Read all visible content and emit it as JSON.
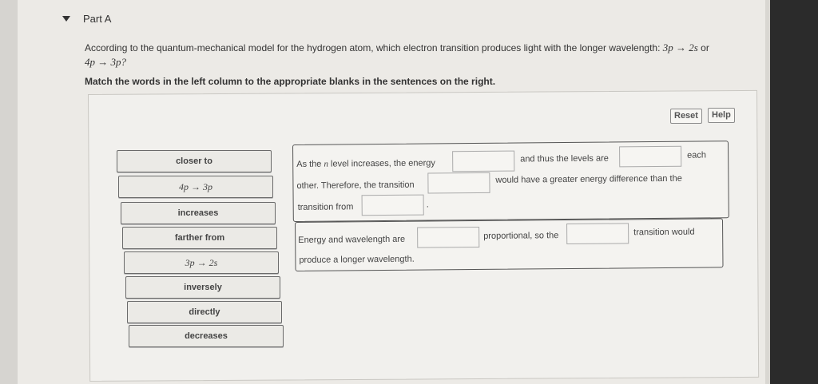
{
  "part": {
    "title": "Part A"
  },
  "question": {
    "text_before": "According to the quantum-mechanical model for the hydrogen atom, which electron transition produces light with the longer wavelength:",
    "transition_1": "3p → 2s",
    "joiner": "or",
    "transition_2": "4p → 3p?"
  },
  "instruction": "Match the words in the left column to the appropriate blanks in the sentences on the right.",
  "buttons": {
    "reset": "Reset",
    "help": "Help"
  },
  "word_bank": [
    "closer to",
    "4p → 3p",
    "increases",
    "farther from",
    "3p → 2s",
    "inversely",
    "directly",
    "decreases"
  ],
  "sentence1": {
    "seg1_pre": "As the ",
    "seg1_n": "n",
    "seg1_post": " level increases, the energy",
    "seg2": "and thus the levels are",
    "seg3": "each",
    "seg4": "other. Therefore, the transition",
    "seg5": "would have a greater energy difference than the",
    "seg6": "transition from",
    "seg7": "."
  },
  "sentence2": {
    "seg1": "Energy and wavelength are",
    "seg2": "proportional, so the",
    "seg3": "transition would",
    "seg4": "produce a longer wavelength."
  }
}
